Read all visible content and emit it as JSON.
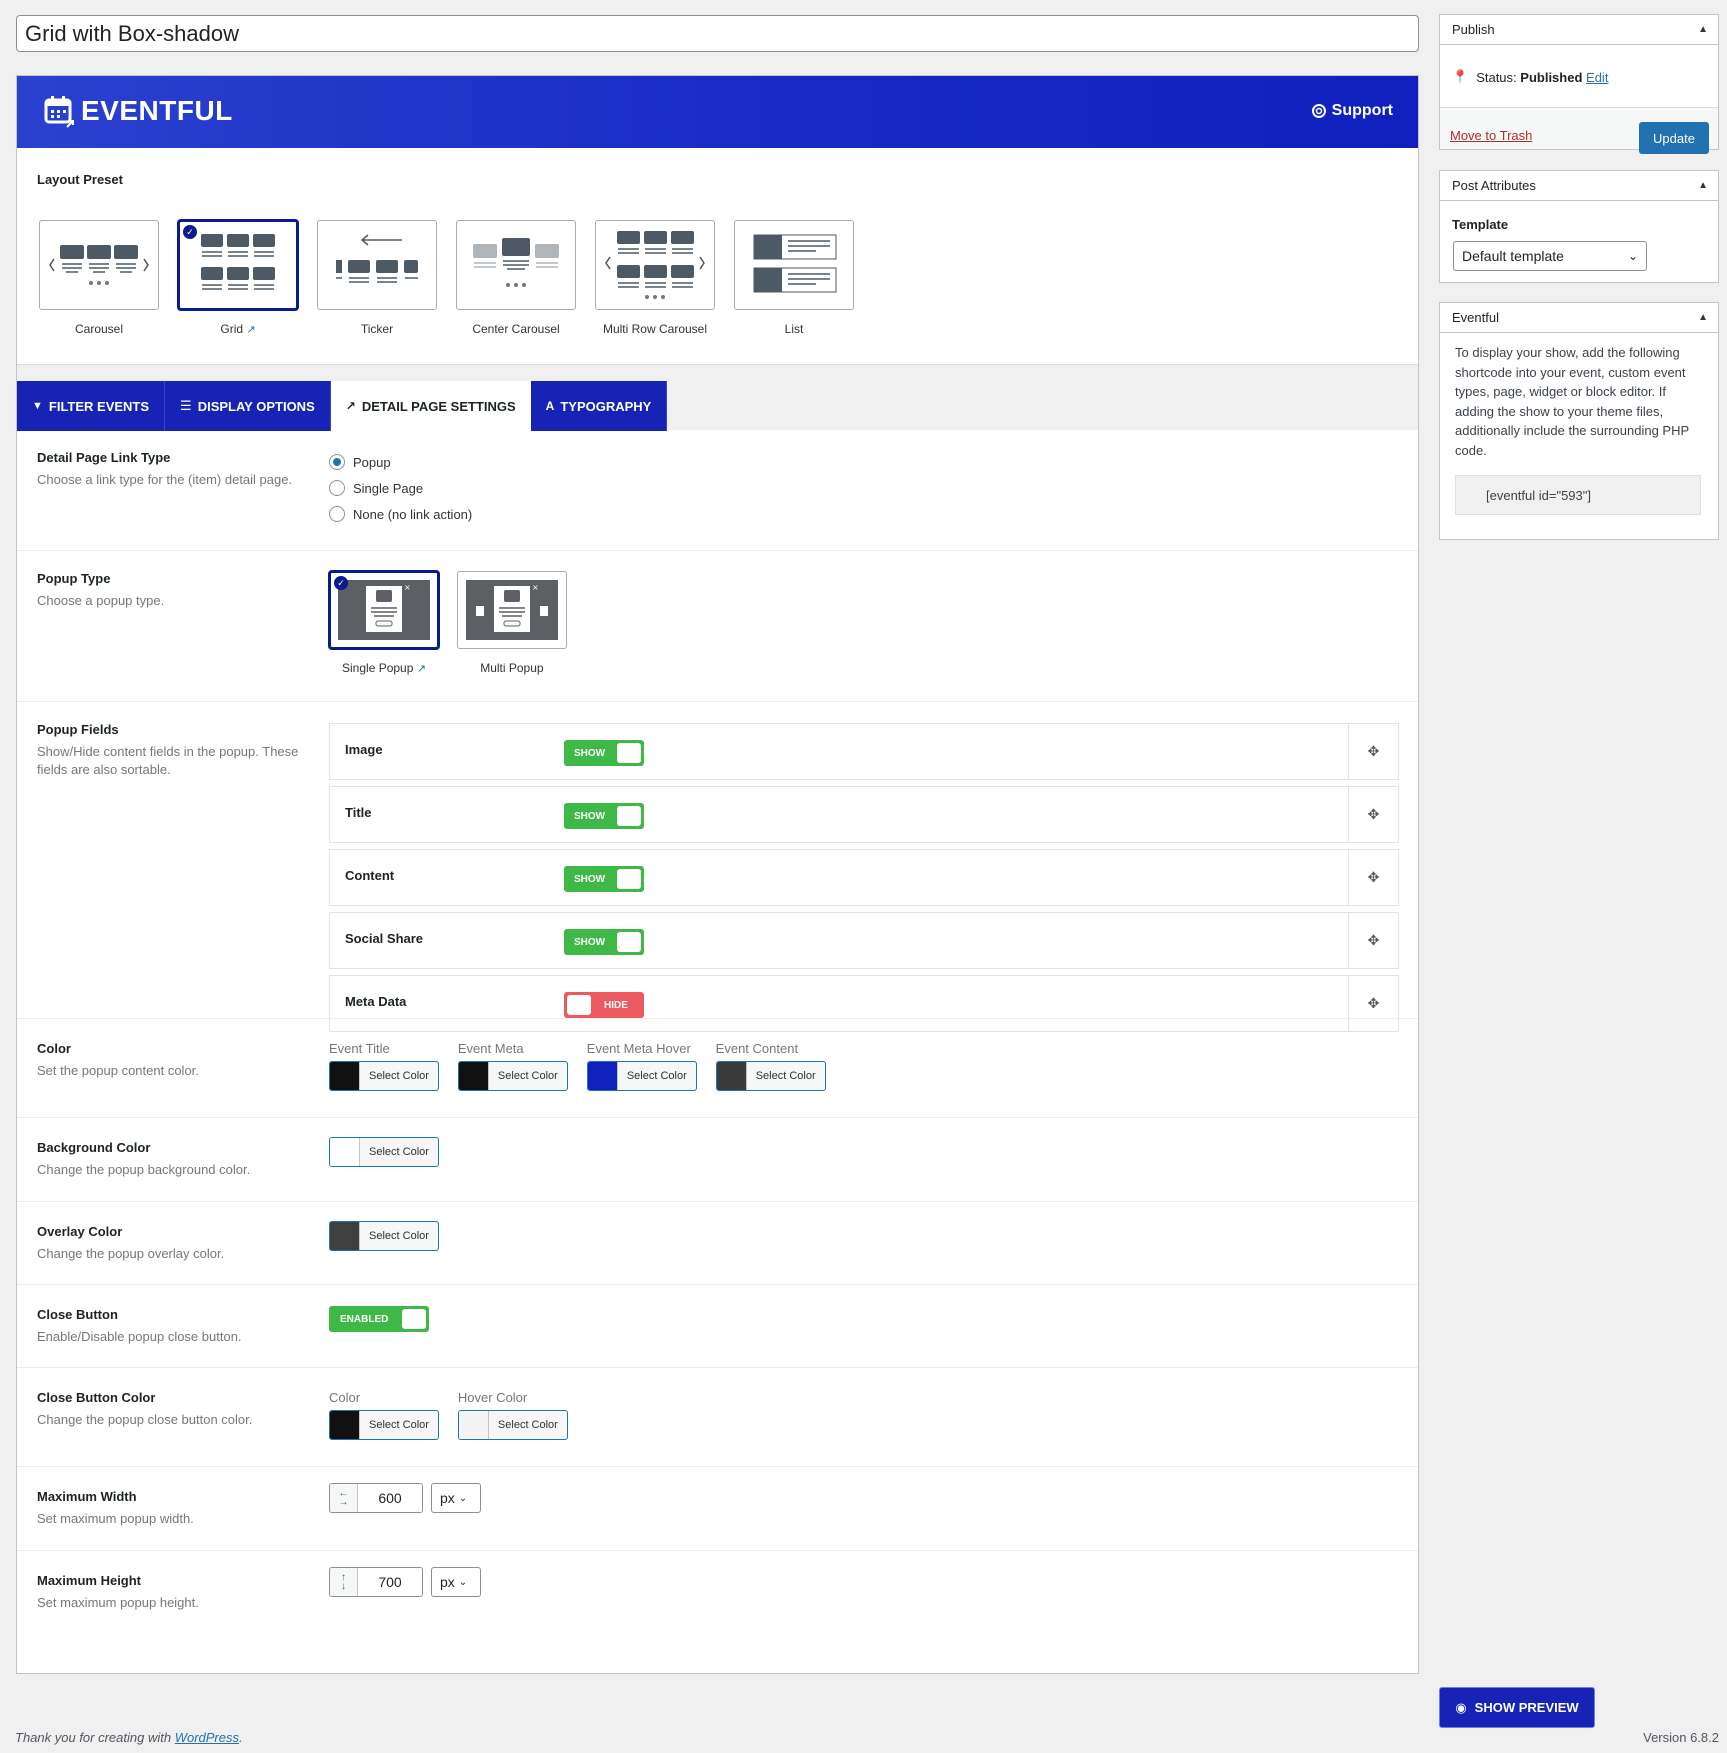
{
  "post_title": "Grid with Box-shadow",
  "banner": {
    "brand": "EVENTFUL",
    "support_label": "Support"
  },
  "layout_preset": {
    "label": "Layout Preset",
    "items": [
      {
        "label": "Carousel",
        "selected": false
      },
      {
        "label": "Grid",
        "selected": true
      },
      {
        "label": "Ticker",
        "selected": false
      },
      {
        "label": "Center Carousel",
        "selected": false
      },
      {
        "label": "Multi Row Carousel",
        "selected": false
      },
      {
        "label": "List",
        "selected": false
      }
    ]
  },
  "tabs": [
    {
      "label": "FILTER EVENTS",
      "icon": "filter-icon"
    },
    {
      "label": "DISPLAY OPTIONS",
      "icon": "list-icon"
    },
    {
      "label": "DETAIL PAGE SETTINGS",
      "icon": "external-link-icon",
      "active": true
    },
    {
      "label": "TYPOGRAPHY",
      "icon": "font-icon"
    }
  ],
  "link_type": {
    "label": "Detail Page Link Type",
    "desc": "Choose a link type for the (item) detail page.",
    "options": [
      "Popup",
      "Single Page",
      "None (no link action)"
    ],
    "selected": "Popup"
  },
  "popup_type": {
    "label": "Popup Type",
    "desc": "Choose a popup type.",
    "options": [
      {
        "label": "Single Popup",
        "selected": true
      },
      {
        "label": "Multi Popup",
        "selected": false
      }
    ]
  },
  "popup_fields": {
    "label": "Popup Fields",
    "desc": "Show/Hide content fields in the popup. These fields are also sortable.",
    "fields": [
      {
        "name": "Image",
        "state": "SHOW"
      },
      {
        "name": "Title",
        "state": "SHOW"
      },
      {
        "name": "Content",
        "state": "SHOW"
      },
      {
        "name": "Social Share",
        "state": "SHOW"
      },
      {
        "name": "Meta Data",
        "state": "HIDE"
      }
    ]
  },
  "color": {
    "label": "Color",
    "desc": "Set the popup content color.",
    "pickers": [
      {
        "label": "Event Title",
        "color": "#111111"
      },
      {
        "label": "Event Meta",
        "color": "#111111"
      },
      {
        "label": "Event Meta Hover",
        "color": "#1020bf"
      },
      {
        "label": "Event Content",
        "color": "#3a3a3a"
      }
    ]
  },
  "select_color_label": "Select Color",
  "bg_color": {
    "label": "Background Color",
    "desc": "Change the popup background color.",
    "color": "#ffffff"
  },
  "overlay_color": {
    "label": "Overlay Color",
    "desc": "Change the popup overlay color.",
    "color": "#3f3f3f"
  },
  "close_button": {
    "label": "Close Button",
    "desc": "Enable/Disable popup close button.",
    "state": "ENABLED"
  },
  "close_button_color": {
    "label": "Close Button Color",
    "desc": "Change the popup close button color.",
    "pickers": [
      {
        "label": "Color",
        "color": "#111111"
      },
      {
        "label": "Hover Color",
        "color": "#f4f4f4"
      }
    ]
  },
  "max_width": {
    "label": "Maximum Width",
    "desc": "Set maximum popup width.",
    "value": "600",
    "unit": "px"
  },
  "max_height": {
    "label": "Maximum Height",
    "desc": "Set maximum popup height.",
    "value": "700",
    "unit": "px"
  },
  "publish": {
    "title": "Publish",
    "status_label": "Status:",
    "status_value": "Published",
    "edit_label": "Edit",
    "trash_label": "Move to Trash",
    "update_label": "Update"
  },
  "post_attributes": {
    "title": "Post Attributes",
    "template_label": "Template",
    "template_value": "Default template"
  },
  "eventful_box": {
    "title": "Eventful",
    "text": "To display your show, add the following shortcode into your event, custom event types, page, widget or block editor. If adding the show to your theme files, additionally include the surrounding PHP code.",
    "shortcode": "[eventful id=\"593\"]"
  },
  "preview_label": "SHOW PREVIEW",
  "footer": {
    "thanks_prefix": "Thank you for creating with ",
    "wp_link": "WordPress",
    "thanks_suffix": ".",
    "version": "Version 6.8.2"
  }
}
